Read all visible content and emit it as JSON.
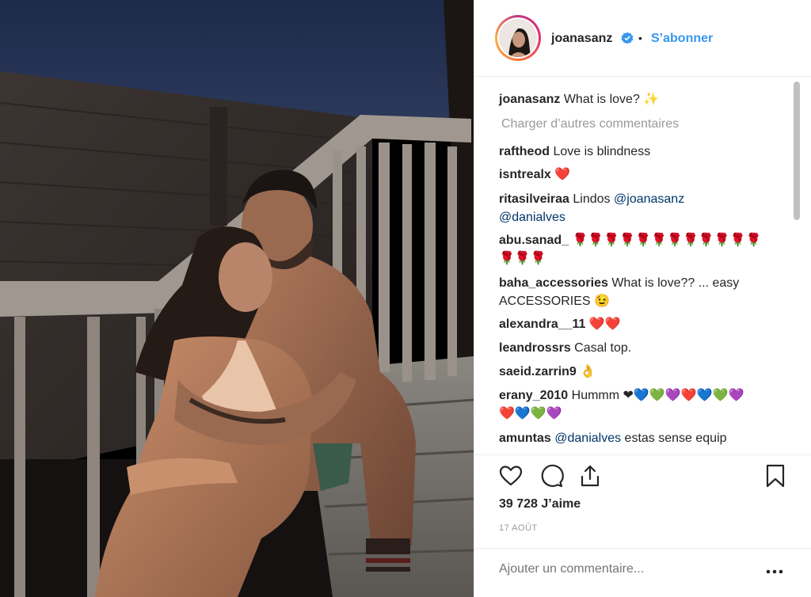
{
  "post": {
    "username": "joanasanz",
    "verified": true,
    "follow_label": "S’abonner",
    "separator": "•"
  },
  "caption": {
    "username": "joanasanz",
    "text": "What is love? ✨"
  },
  "load_more_label": "Charger d’autres commentaires",
  "comments": [
    {
      "username": "raftheod",
      "text": "Love is blindness"
    },
    {
      "username": "isntrealx",
      "text": "❤️"
    },
    {
      "username": "ritasilveiraa",
      "text": "Lindos",
      "mention1": "@joanasanz",
      "mention2": "@danialves"
    },
    {
      "username": "abu.sanad_",
      "text": "🌹🌹🌹🌹🌹🌹🌹🌹🌹🌹🌹🌹",
      "text2": "🌹🌹🌹"
    },
    {
      "username": "baha_accessories",
      "text": "What is love?? ... easy",
      "text2": "ACCESSORIES 😉"
    },
    {
      "username": "alexandra__11",
      "text": "❤️❤️"
    },
    {
      "username": "leandrossrs",
      "text": "Casal top."
    },
    {
      "username": "saeid.zarrin9",
      "text": "👌"
    },
    {
      "username": "erany_2010",
      "text": "Hummm ❤💙💚💜❤️💙💚💜",
      "text2": "❤️💙💚💜"
    },
    {
      "username": "amuntas",
      "mention": "@danialves",
      "text": "estas sense equip"
    }
  ],
  "likes_label": "39 728 J’aime",
  "date_label": "17 AOÛT",
  "add_comment_placeholder": "Ajouter un commentaire...",
  "icons": {
    "like": "heart-icon",
    "comment": "comment-icon",
    "share": "share-icon",
    "save": "bookmark-icon",
    "more": "more-options-icon"
  },
  "colors": {
    "link_blue": "#3897f0",
    "mention_blue": "#003569",
    "verified_blue": "#3897f0",
    "text": "#262626",
    "muted": "#999999"
  }
}
